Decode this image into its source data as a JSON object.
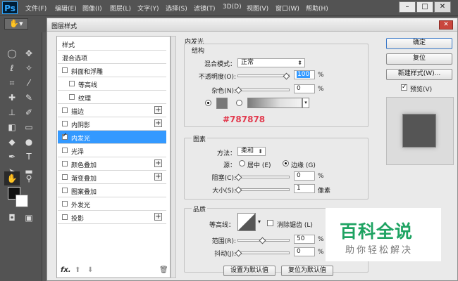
{
  "app": {
    "logo": "Ps",
    "menu": [
      "文件(F)",
      "编辑(E)",
      "图像(I)",
      "图层(L)",
      "文字(Y)",
      "选择(S)",
      "滤镜(T)",
      "3D(D)",
      "视图(V)",
      "窗口(W)",
      "帮助(H)"
    ],
    "window_controls": [
      "–",
      "□",
      "✕"
    ]
  },
  "tools": {
    "icons": [
      "marquee-icon",
      "move-icon",
      "lasso-icon",
      "magic-wand-icon",
      "crop-icon",
      "eyedropper-icon",
      "healing-icon",
      "brush-icon",
      "stamp-icon",
      "history-brush-icon",
      "eraser-icon",
      "gradient-icon",
      "blur-icon",
      "dodge-icon",
      "pen-icon",
      "type-icon",
      "path-select-icon",
      "shape-icon",
      "hand-icon",
      "zoom-icon"
    ],
    "foreground": "#111111",
    "background": "#ffffff"
  },
  "dialog": {
    "title": "图层样式",
    "close": "✕",
    "style_list": [
      {
        "label": "样式",
        "checkbox": false,
        "checked": false,
        "plus": false,
        "indent": 0
      },
      {
        "label": "混合选项",
        "checkbox": false,
        "checked": false,
        "plus": false,
        "indent": 0
      },
      {
        "label": "斜面和浮雕",
        "checkbox": true,
        "checked": false,
        "plus": false,
        "indent": 0
      },
      {
        "label": "等高线",
        "checkbox": true,
        "checked": false,
        "plus": false,
        "indent": 1
      },
      {
        "label": "纹理",
        "checkbox": true,
        "checked": false,
        "plus": false,
        "indent": 1
      },
      {
        "label": "描边",
        "checkbox": true,
        "checked": false,
        "plus": true,
        "indent": 0
      },
      {
        "label": "内阴影",
        "checkbox": true,
        "checked": false,
        "plus": true,
        "indent": 0
      },
      {
        "label": "内发光",
        "checkbox": true,
        "checked": true,
        "plus": false,
        "indent": 0,
        "selected": true
      },
      {
        "label": "光泽",
        "checkbox": true,
        "checked": false,
        "plus": false,
        "indent": 0
      },
      {
        "label": "颜色叠加",
        "checkbox": true,
        "checked": false,
        "plus": true,
        "indent": 0
      },
      {
        "label": "渐变叠加",
        "checkbox": true,
        "checked": false,
        "plus": true,
        "indent": 0
      },
      {
        "label": "图案叠加",
        "checkbox": true,
        "checked": false,
        "plus": false,
        "indent": 0
      },
      {
        "label": "外发光",
        "checkbox": true,
        "checked": false,
        "plus": false,
        "indent": 0
      },
      {
        "label": "投影",
        "checkbox": true,
        "checked": false,
        "plus": true,
        "indent": 0
      }
    ],
    "footer": {
      "fx": "fx.",
      "up": "⬆",
      "down": "⬇",
      "trash": "🗑"
    },
    "inner_glow": {
      "title": "内发光",
      "structure": {
        "title": "结构",
        "blend_mode_label": "混合模式：",
        "blend_mode_value": "正常",
        "opacity_label": "不透明度(O):",
        "opacity_value": "100",
        "opacity_fraction": 1.0,
        "noise_label": "杂色(N):",
        "noise_value": "0",
        "noise_fraction": 0.0,
        "unit": "%",
        "glow_color": "#787878"
      },
      "elements": {
        "title": "图素",
        "method_label": "方法：",
        "method_value": "柔和",
        "source_label": "源：",
        "source_center": "居中 (E)",
        "source_edge": "边缘 (G)",
        "source_selected": "edge",
        "choke_label": "阻塞(C):",
        "choke_value": "0",
        "choke_fraction": 0.0,
        "size_label": "大小(S):",
        "size_value": "1",
        "size_fraction": 0.0,
        "unit_pct": "%",
        "unit_px": "像素"
      },
      "quality": {
        "title": "品质",
        "contour_label": "等高线：",
        "antialias_label": "消除锯齿 (L)",
        "range_label": "范围(R):",
        "range_value": "50",
        "range_fraction": 0.5,
        "jitter_label": "抖动(J):",
        "jitter_value": "0",
        "jitter_fraction": 0.0,
        "unit": "%"
      },
      "buttons": {
        "make_default": "设置为默认值",
        "reset_default": "复位为默认值"
      }
    },
    "right": {
      "ok": "确定",
      "reset": "复位",
      "new_style": "新建样式(W)...",
      "preview_label": "预览(V)",
      "preview_checked": true,
      "preview_color": "#555555"
    },
    "annotation": "#787878"
  },
  "watermark": {
    "title": "百科全说",
    "subtitle": "助你轻松解决",
    "color": "#1ea362"
  }
}
